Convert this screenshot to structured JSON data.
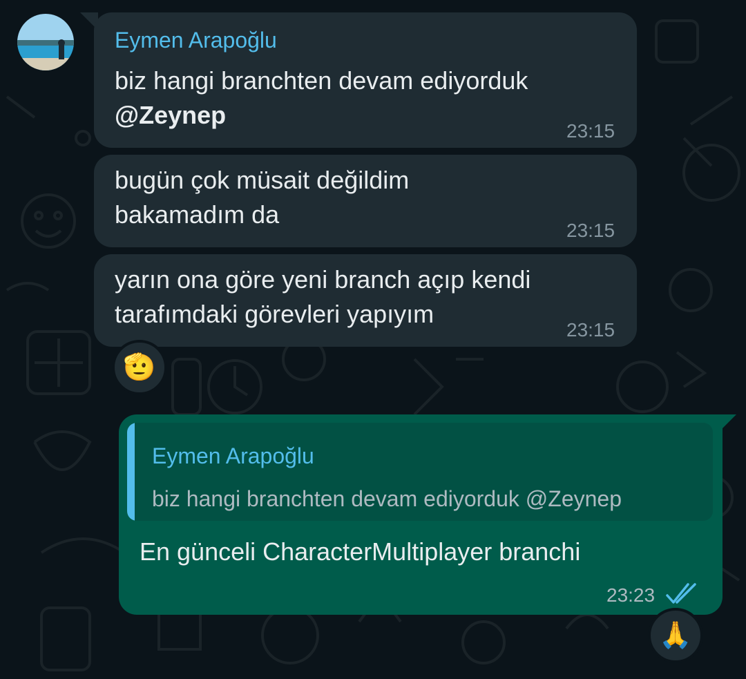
{
  "incoming": {
    "sender_name": "Eymen Arapoğlu",
    "messages": [
      {
        "line1": "biz hangi branchten devam ediyorduk",
        "mention": "@Zeynep",
        "time": "23:15"
      },
      {
        "line1": "bugün çok müsait değildim",
        "line2": "bakamadım da",
        "time": "23:15"
      },
      {
        "line1": "yarın ona göre yeni branch açıp kendi",
        "line2": "tarafımdaki görevleri yapıyım",
        "time": "23:15",
        "reaction": "🫡"
      }
    ]
  },
  "outgoing": {
    "quote": {
      "sender_name": "Eymen Arapoğlu",
      "text": "biz hangi branchten devam ediyorduk @Zeynep"
    },
    "text": "En günceli CharacterMultiplayer branchi",
    "time": "23:23",
    "status": "read",
    "reaction": "🙏"
  },
  "colors": {
    "background": "#0b141a",
    "incoming_bubble": "#1f2c33",
    "outgoing_bubble": "#005c4b",
    "sender_name": "#53bdeb",
    "mention": "#25d366",
    "read_ticks": "#53bdeb"
  },
  "icons": {
    "avatar": "profile-photo-avatar",
    "status": "double-check-read-icon"
  }
}
